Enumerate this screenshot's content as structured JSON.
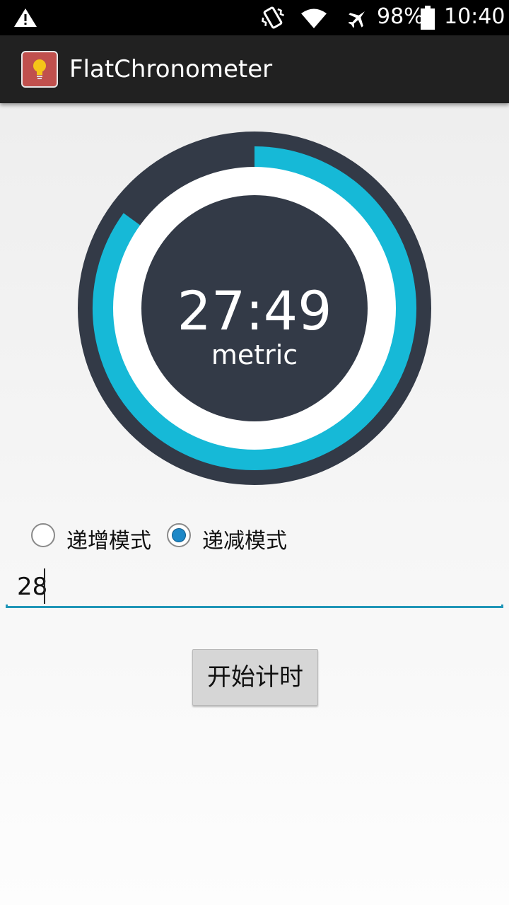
{
  "status_bar": {
    "battery": "98%",
    "time": "10:40",
    "icons": [
      "alert-icon",
      "vibrate-icon",
      "wifi-icon",
      "airplane-icon",
      "battery-icon"
    ]
  },
  "app_bar": {
    "title": "FlatChronometer",
    "icon": "lightbulb-icon"
  },
  "timer": {
    "time": "27:49",
    "unit": "metric",
    "progress": 0.85,
    "colors": {
      "dark": "#333a47",
      "accent": "#16b9d7",
      "white": "#ffffff"
    }
  },
  "mode": {
    "options": [
      "递增模式",
      "递减模式"
    ],
    "selected": "递减模式"
  },
  "input": {
    "value": "28"
  },
  "start_button": {
    "label": "开始计时"
  }
}
